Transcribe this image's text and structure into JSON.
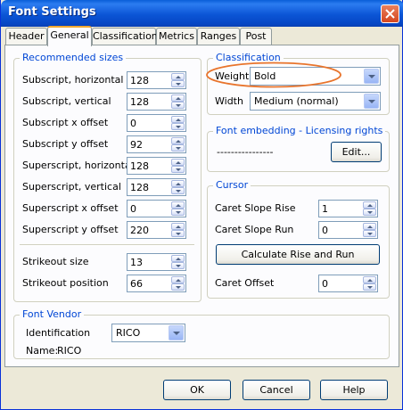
{
  "window": {
    "title": "Font Settings"
  },
  "tabs": [
    {
      "label": "Header"
    },
    {
      "label": "General"
    },
    {
      "label": "Classification"
    },
    {
      "label": "Metrics"
    },
    {
      "label": "Ranges"
    },
    {
      "label": "Post"
    }
  ],
  "recommended": {
    "title": "Recommended sizes",
    "fields": [
      {
        "label": "Subscript, horizontal",
        "value": "128"
      },
      {
        "label": "Subscript, vertical",
        "value": "128"
      },
      {
        "label": "Subscript x offset",
        "value": "0"
      },
      {
        "label": "Subscript y offset",
        "value": "92"
      },
      {
        "label": "Superscript, horizontal",
        "value": "128"
      },
      {
        "label": "Superscript, vertical",
        "value": "128"
      },
      {
        "label": "Superscript x offset",
        "value": "0"
      },
      {
        "label": "Superscript y offset",
        "value": "220"
      },
      {
        "label": "Strikeout size",
        "value": "13"
      },
      {
        "label": "Strikeout position",
        "value": "66"
      }
    ]
  },
  "classification": {
    "title": "Classification",
    "weight_label": "Weight",
    "weight_value": "Bold",
    "width_label": "Width",
    "width_value": "Medium (normal)"
  },
  "embedding": {
    "title": "Font embedding - Licensing rights",
    "value": "----------------",
    "edit_label": "Edit..."
  },
  "cursor": {
    "title": "Cursor",
    "rise_label": "Caret Slope Rise",
    "rise_value": "1",
    "run_label": "Caret Slope Run",
    "run_value": "0",
    "calc_label": "Calculate Rise and Run",
    "offset_label": "Caret Offset",
    "offset_value": "0"
  },
  "vendor": {
    "title": "Font Vendor",
    "id_label": "Identification",
    "id_value": "RICO",
    "name_label": "Name:",
    "name_value": "RICO"
  },
  "footer": {
    "ok": "OK",
    "cancel": "Cancel",
    "help": "Help"
  },
  "colors": {
    "titlebar": "#0a5fd8",
    "group_title": "#0046d5",
    "highlight_ellipse": "#e8742c"
  }
}
